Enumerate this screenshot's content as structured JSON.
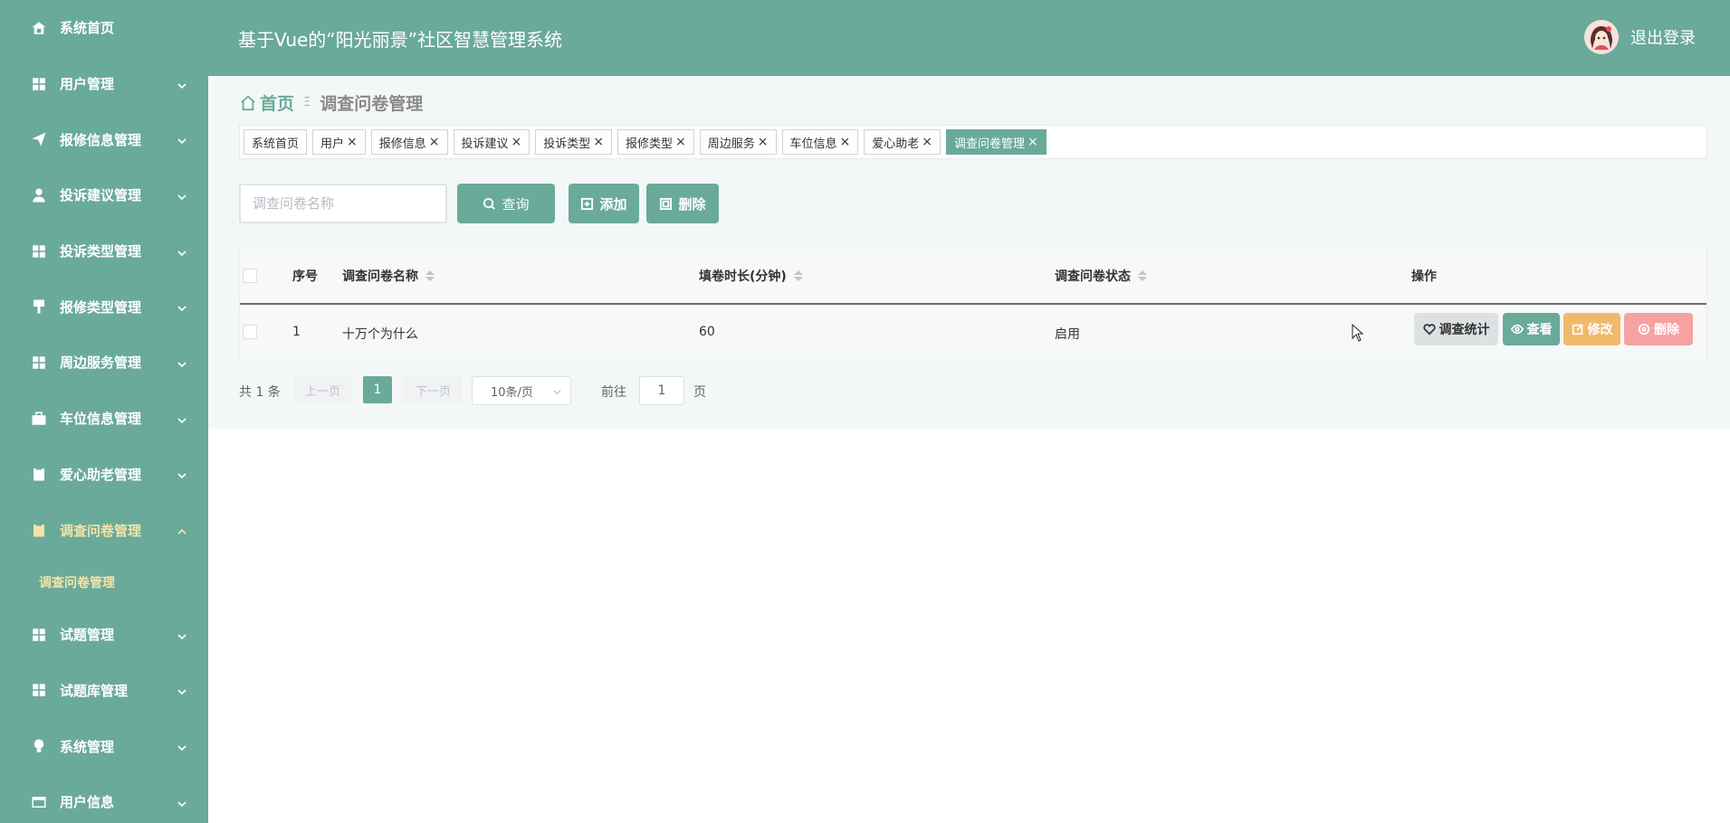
{
  "header": {
    "title": "基于Vue的“阳光丽景”社区智慧管理系统",
    "logout_label": "退出登录"
  },
  "sidebar": {
    "items": [
      {
        "label": "系统首页",
        "icon": "home-icon"
      },
      {
        "label": "用户管理",
        "icon": "grid-icon"
      },
      {
        "label": "报修信息管理",
        "icon": "paper-plane-icon"
      },
      {
        "label": "投诉建议管理",
        "icon": "user-icon"
      },
      {
        "label": "投诉类型管理",
        "icon": "grid-icon"
      },
      {
        "label": "报修类型管理",
        "icon": "brush-icon"
      },
      {
        "label": "周边服务管理",
        "icon": "grid-icon"
      },
      {
        "label": "车位信息管理",
        "icon": "briefcase-icon"
      },
      {
        "label": "爱心助老管理",
        "icon": "clipboard-icon"
      },
      {
        "label": "调查问卷管理",
        "icon": "clipboard-icon"
      },
      {
        "label": "试题管理",
        "icon": "grid-icon"
      },
      {
        "label": "试题库管理",
        "icon": "grid-icon"
      },
      {
        "label": "系统管理",
        "icon": "bulb-icon"
      },
      {
        "label": "用户信息",
        "icon": "card-icon"
      }
    ],
    "submenu_label": "调查问卷管理"
  },
  "breadcrumb": {
    "home": "首页",
    "separator": "Ξ",
    "current": "调查问卷管理"
  },
  "tags": [
    "系统首页",
    "用户",
    "报修信息",
    "投诉建议",
    "投诉类型",
    "报修类型",
    "周边服务",
    "车位信息",
    "爱心助老",
    "调查问卷管理"
  ],
  "tag_close": "×",
  "search": {
    "placeholder": "调查问卷名称",
    "search_label": "查询",
    "add_label": "添加",
    "delete_label": "删除"
  },
  "table": {
    "columns": [
      "序号",
      "调查问卷名称",
      "填卷时长(分钟)",
      "调查问卷状态",
      "操作"
    ],
    "rows": [
      {
        "index": "1",
        "name": "十万个为什么",
        "duration": "60",
        "status": "启用"
      }
    ],
    "actions": {
      "stats": "调查统计",
      "view": "查看",
      "edit": "修改",
      "delete": "删除"
    }
  },
  "pagination": {
    "total_text": "共 1 条",
    "prev": "上一页",
    "current": "1",
    "next": "下一页",
    "page_size": "10条/页",
    "goto_label": "前往",
    "goto_value": "1",
    "page_suffix": "页"
  },
  "colors": {
    "primary": "#6aaa9a",
    "active_menu": "#f6e3a6",
    "edit": "#f0b96c",
    "danger": "#f6a2a2"
  }
}
